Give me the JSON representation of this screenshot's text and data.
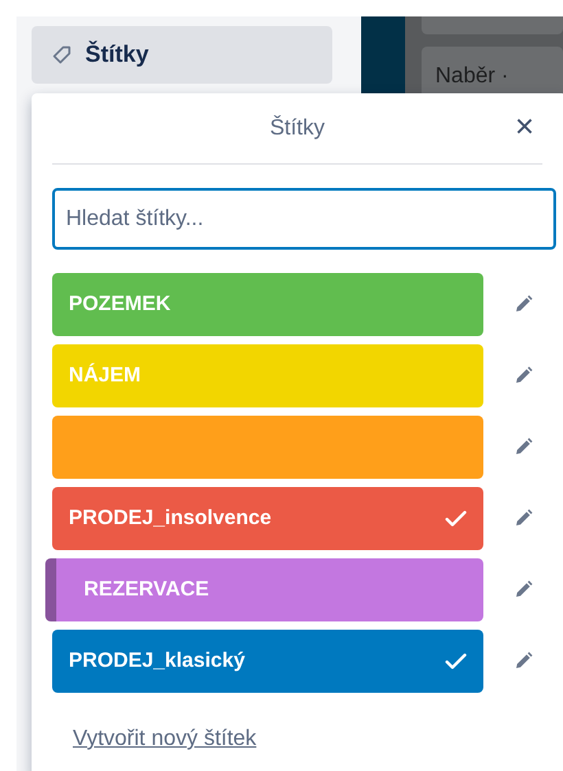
{
  "sidebar_button": {
    "label": "Štítky"
  },
  "background_card": {
    "label": "Naběr ·"
  },
  "popup": {
    "title": "Štítky",
    "close": "×",
    "search": {
      "placeholder": "Hledat štítky..."
    },
    "labels": [
      {
        "name": "POZEMEK",
        "color": "#61bd4f",
        "checked": false,
        "hovered": false
      },
      {
        "name": "NÁJEM",
        "color": "#f2d600",
        "checked": false,
        "hovered": false
      },
      {
        "color": "#ff9f1a",
        "checked": false,
        "hovered": false
      },
      {
        "name": "PRODEJ_insolvence",
        "color": "#eb5a46",
        "checked": true,
        "hovered": false
      },
      {
        "name": "REZERVACE",
        "color": "#c377e0",
        "checked": false,
        "hovered": true
      },
      {
        "name": "PRODEJ_klasický",
        "color": "#0079bf",
        "checked": true,
        "hovered": false
      }
    ],
    "create_link": "Vytvořit nový štítek"
  }
}
